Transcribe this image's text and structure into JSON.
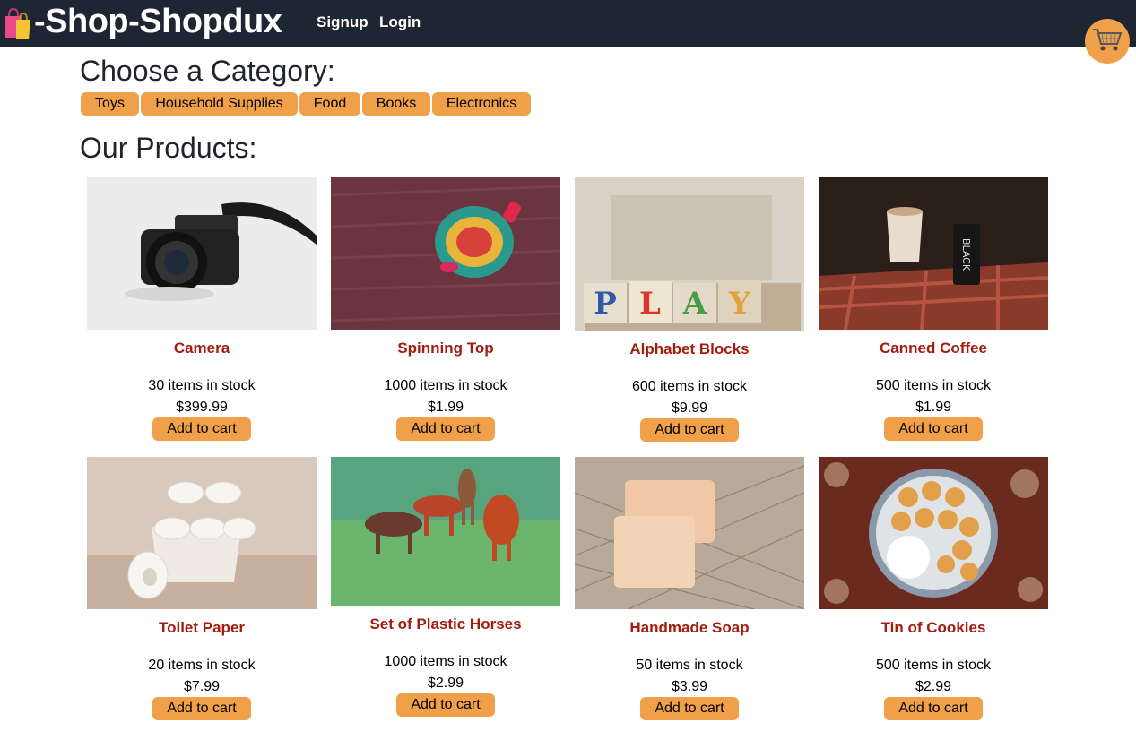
{
  "app": {
    "brand": "-Shop-Shopdux",
    "brand_icon": "shopping-bags-icon",
    "nav": {
      "signup": "Signup",
      "login": "Login"
    },
    "cart_icon": "shopping-cart-icon"
  },
  "categories": {
    "heading": "Choose a Category:",
    "items": [
      "Toys",
      "Household Supplies",
      "Food",
      "Books",
      "Electronics"
    ]
  },
  "products": {
    "heading": "Our Products:",
    "add_label": "Add to cart",
    "items": [
      {
        "name": "Camera",
        "stock": "30 items in stock",
        "price": "$399.99"
      },
      {
        "name": "Spinning Top",
        "stock": "1000 items in stock",
        "price": "$1.99"
      },
      {
        "name": "Alphabet Blocks",
        "stock": "600 items in stock",
        "price": "$9.99"
      },
      {
        "name": "Canned Coffee",
        "stock": "500 items in stock",
        "price": "$1.99"
      },
      {
        "name": "Toilet Paper",
        "stock": "20 items in stock",
        "price": "$7.99"
      },
      {
        "name": "Set of Plastic Horses",
        "stock": "1000 items in stock",
        "price": "$2.99"
      },
      {
        "name": "Handmade Soap",
        "stock": "50 items in stock",
        "price": "$3.99"
      },
      {
        "name": "Tin of Cookies",
        "stock": "500 items in stock",
        "price": "$2.99"
      }
    ]
  },
  "colors": {
    "navbar": "#1f2633",
    "accent": "#f0a048",
    "product_name": "#a31c0e"
  }
}
